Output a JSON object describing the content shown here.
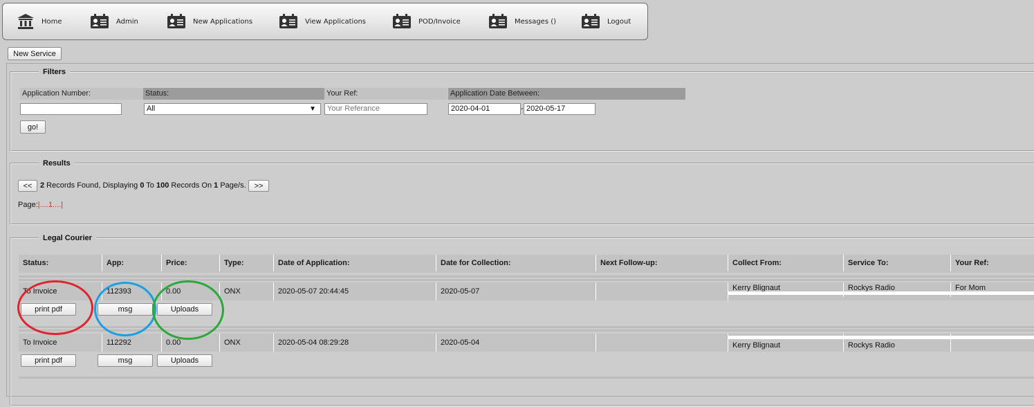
{
  "nav": {
    "items": [
      {
        "label": "Home",
        "icon": "bank-icon"
      },
      {
        "label": "Admin",
        "icon": "id-card-icon"
      },
      {
        "label": "New Applications",
        "icon": "id-card-icon"
      },
      {
        "label": "View Applications",
        "icon": "id-card-icon"
      },
      {
        "label": "POD/Invoice",
        "icon": "id-card-icon"
      },
      {
        "label": "Messages ()",
        "icon": "id-card-icon"
      },
      {
        "label": "Logout",
        "icon": "id-card-icon"
      }
    ]
  },
  "new_service_label": "New Service",
  "filters": {
    "legend": "Filters",
    "app_number_label": "Application Number:",
    "app_number_value": "",
    "status_label": "Status:",
    "status_value": "All",
    "your_ref_label": "Your Ref:",
    "your_ref_placeholder": "Your Referance",
    "date_label": "Application Date Between:",
    "date_from": "2020-04-01",
    "date_sep": "-",
    "date_to": "2020-05-17",
    "go_label": "go!"
  },
  "results": {
    "legend": "Results",
    "prev_label": "<<",
    "next_label": ">>",
    "records_found": "2",
    "records_text": " Records Found, Displaying ",
    "from": "0",
    "to_text": " To ",
    "to": "100",
    "on_text": " Records On ",
    "pages": "1",
    "pages_suffix": " Page/s.",
    "page_label": "Page:",
    "page_links": "|....",
    "current_page": "1",
    "page_links_end": "....|"
  },
  "courier": {
    "legend": "Legal Courier",
    "headers": [
      "Status:",
      "App:",
      "Price:",
      "Type:",
      "Date of Application:",
      "Date for Collection:",
      "Next Follow-up:",
      "Collect From:",
      "Service To:",
      "Your Ref:"
    ],
    "rows": [
      {
        "status": "To Invoice",
        "app": "112393",
        "price": "0.00",
        "type": "ONX",
        "date_app": "2020-05-07 20:44:45",
        "date_collect": "2020-05-07",
        "next": "",
        "collect_from": "Kerry Blignaut",
        "service_to": "Rockys Radio",
        "your_ref": "For Mom"
      },
      {
        "status": "To Invoice",
        "app": "112292",
        "price": "0.00",
        "type": "ONX",
        "date_app": "2020-05-04 08:29:28",
        "date_collect": "2020-05-04",
        "next": "",
        "collect_from": "Kerry Blignaut",
        "service_to": "Rockys Radio",
        "your_ref": ""
      }
    ],
    "print_label": "print pdf",
    "msg_label": "msg",
    "uploads_label": "Uploads"
  },
  "colors": {
    "annotation_red": "#e0242b",
    "annotation_blue": "#1aa0e0",
    "annotation_green": "#2aa83a",
    "header_dark": "#9a9a9a",
    "header_light": "#c3c3c3"
  }
}
